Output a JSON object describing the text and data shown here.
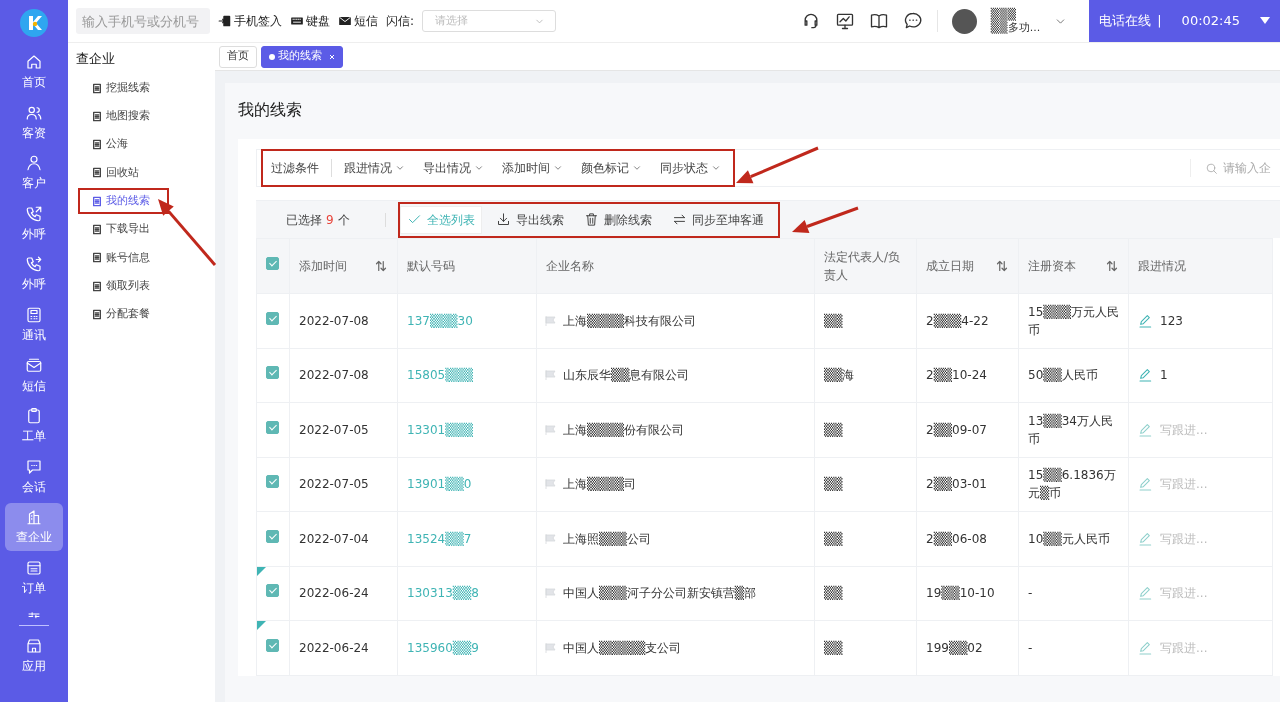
{
  "top_bar": {
    "dial_placeholder": "输入手机号或分机号",
    "actions": [
      "手机签入",
      "键盘",
      "短信"
    ],
    "flash_label": "闪信:",
    "flash_placeholder": "请选择",
    "user": {
      "name": "▒▒▒",
      "role": "▒▒多功..."
    },
    "phone_status": "电话在线",
    "phone_separator": "|",
    "timer": "00:02:45"
  },
  "rail": [
    {
      "label": "首页",
      "selected": false
    },
    {
      "label": "客资",
      "selected": false
    },
    {
      "label": "客户",
      "selected": false
    },
    {
      "label": "外呼",
      "selected": false
    },
    {
      "label": "外呼",
      "selected": false
    },
    {
      "label": "通讯",
      "selected": false
    },
    {
      "label": "短信",
      "selected": false
    },
    {
      "label": "工单",
      "selected": false
    },
    {
      "label": "会话",
      "selected": false
    },
    {
      "label": "查企业",
      "selected": true
    },
    {
      "label": "订单",
      "selected": false
    },
    {
      "label": "应用",
      "selected": false
    }
  ],
  "sidebar": {
    "title": "查企业",
    "items": [
      {
        "label": "挖掘线索",
        "selected": false,
        "annotated": false
      },
      {
        "label": "地图搜索",
        "selected": false,
        "annotated": false
      },
      {
        "label": "公海",
        "selected": false,
        "annotated": false
      },
      {
        "label": "回收站",
        "selected": false,
        "annotated": false
      },
      {
        "label": "我的线索",
        "selected": true,
        "annotated": true
      },
      {
        "label": "下载导出",
        "selected": false,
        "annotated": false
      },
      {
        "label": "账号信息",
        "selected": false,
        "annotated": false
      },
      {
        "label": "领取列表",
        "selected": false,
        "annotated": false
      },
      {
        "label": "分配套餐",
        "selected": false,
        "annotated": false
      }
    ]
  },
  "tabs": [
    {
      "label": "首页",
      "selected": false,
      "closable": false
    },
    {
      "label": "我的线索",
      "selected": true,
      "closable": true
    }
  ],
  "page_title": "我的线索",
  "filter_bar": {
    "annotated": true,
    "label": "过滤条件",
    "filters": [
      "跟进情况",
      "导出情况",
      "添加时间",
      "颜色标记",
      "同步状态"
    ],
    "search_placeholder": "请输入企"
  },
  "action_bar": {
    "annotated": true,
    "selected_prefix": "已选择",
    "selected_count": "9",
    "selected_suffix": "个",
    "actions": [
      {
        "label": "全选列表",
        "selected": true
      },
      {
        "label": "导出线索",
        "selected": false
      },
      {
        "label": "删除线索",
        "selected": false
      },
      {
        "label": "同步至坤客通",
        "selected": false
      }
    ]
  },
  "table": {
    "all_checked": true,
    "columns": [
      {
        "label": "添加时间",
        "sortable": true
      },
      {
        "label": "默认号码",
        "sortable": false
      },
      {
        "label": "企业名称",
        "sortable": false
      },
      {
        "label": "法定代表人/负责人",
        "sortable": false
      },
      {
        "label": "成立日期",
        "sortable": true
      },
      {
        "label": "注册资本",
        "sortable": true
      },
      {
        "label": "跟进情况",
        "sortable": false
      }
    ],
    "rows": [
      {
        "checked": true,
        "flagged": false,
        "date": "2022-07-08",
        "phone": "137▒▒▒30",
        "company": "上海▒▒▒▒科技有限公司",
        "legal": "▒▒",
        "founded": "2▒▒▒4-22",
        "capital": "15▒▒▒万元人民币",
        "follow_up": "123",
        "follow_empty": false
      },
      {
        "checked": true,
        "flagged": false,
        "date": "2022-07-08",
        "phone": "15805▒▒▒",
        "company": "山东辰华▒▒息有限公司",
        "legal": "▒▒海",
        "founded": "2▒▒10-24",
        "capital": "50▒▒人民币",
        "follow_up": "1",
        "follow_empty": false
      },
      {
        "checked": true,
        "flagged": false,
        "date": "2022-07-05",
        "phone": "13301▒▒▒",
        "company": "上海▒▒▒▒份有限公司",
        "legal": "▒▒",
        "founded": "2▒▒09-07",
        "capital": "13▒▒34万人民币",
        "follow_up": "写跟进...",
        "follow_empty": true
      },
      {
        "checked": true,
        "flagged": false,
        "date": "2022-07-05",
        "phone": "13901▒▒0",
        "company": "上海▒▒▒▒司",
        "legal": "▒▒",
        "founded": "2▒▒03-01",
        "capital": "15▒▒6.1836万元▒币",
        "follow_up": "写跟进...",
        "follow_empty": true
      },
      {
        "checked": true,
        "flagged": false,
        "date": "2022-07-04",
        "phone": "13524▒▒7",
        "company": "上海照▒▒▒公司",
        "legal": "▒▒",
        "founded": "2▒▒06-08",
        "capital": "10▒▒元人民币",
        "follow_up": "写跟进...",
        "follow_empty": true
      },
      {
        "checked": true,
        "flagged": true,
        "date": "2022-06-24",
        "phone": "130313▒▒8",
        "company": "中国人▒▒▒河子分公司新安镇营▒部",
        "legal": "▒▒",
        "founded": "19▒▒10-10",
        "capital": "-",
        "follow_up": "写跟进...",
        "follow_empty": true
      },
      {
        "checked": true,
        "flagged": true,
        "date": "2022-06-24",
        "phone": "135960▒▒9",
        "company": "中国人▒▒▒▒▒支公司",
        "legal": "▒▒",
        "founded": "199▒▒02",
        "capital": "-",
        "follow_up": "写跟进...",
        "follow_empty": true
      }
    ]
  }
}
